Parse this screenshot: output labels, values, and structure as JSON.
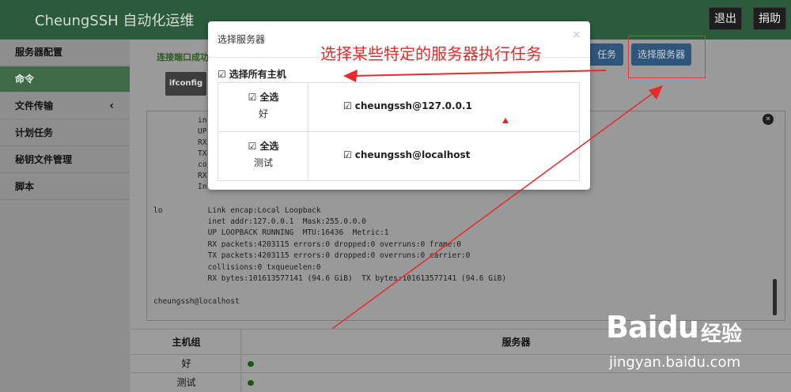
{
  "app": {
    "title": "CheungSSH 自动化运维"
  },
  "topbar": {
    "logout": "退出",
    "donate": "捐助"
  },
  "sidebar": {
    "items": [
      {
        "label": "服务器配置",
        "active": false
      },
      {
        "label": "命令",
        "active": true
      },
      {
        "label": "文件传输",
        "active": false,
        "chevron": "‹"
      },
      {
        "label": "计划任务",
        "active": false
      },
      {
        "label": "秘钥文件管理",
        "active": false
      },
      {
        "label": "脚本",
        "active": false
      }
    ]
  },
  "main": {
    "status_text": "连接端口成功",
    "command_button": "ifconfig",
    "task_button": "任务",
    "select_servers_button": "选择服务器"
  },
  "terminal": {
    "lines": [
      "in",
      "UP",
      "RX",
      "TX",
      "co",
      "RX",
      "In",
      "",
      "lo          Link encap:Local Loopback",
      "            inet addr:127.0.0.1  Mask:255.0.0.0",
      "            UP LOOPBACK RUNNING  MTU:16436  Metric:1",
      "            RX packets:4203115 errors:0 dropped:0 overruns:0 frame:0",
      "            TX packets:4203115 errors:0 dropped:0 overruns:0 carrier:0",
      "            collisions:0 txqueuelen:0",
      "            RX bytes:101613577141 (94.6 GiB)  TX bytes:101613577141 (94.6 GiB)",
      "",
      "cheungssh@localhost"
    ],
    "close_icon": "×"
  },
  "host_table": {
    "headers": {
      "group": "主机组",
      "servers": "服务器"
    },
    "rows": [
      {
        "group": "好"
      },
      {
        "group": "测试"
      }
    ],
    "status_color": "#145a14"
  },
  "modal": {
    "title": "选择服务器",
    "close": "×",
    "select_all_hosts": "选择所有主机",
    "check_icon": "☑",
    "groups": [
      {
        "select_all": "全选",
        "name": "好",
        "host": "cheungssh@127.0.0.1"
      },
      {
        "select_all": "全选",
        "name": "测试",
        "host": "cheungssh@localhost"
      }
    ]
  },
  "annotation": {
    "text": "选择某些特定的服务器执行任务",
    "color": "#e52b2b"
  },
  "watermark": {
    "logo": "Baidu",
    "cn": "经验",
    "url": "jingyan.baidu.com"
  }
}
